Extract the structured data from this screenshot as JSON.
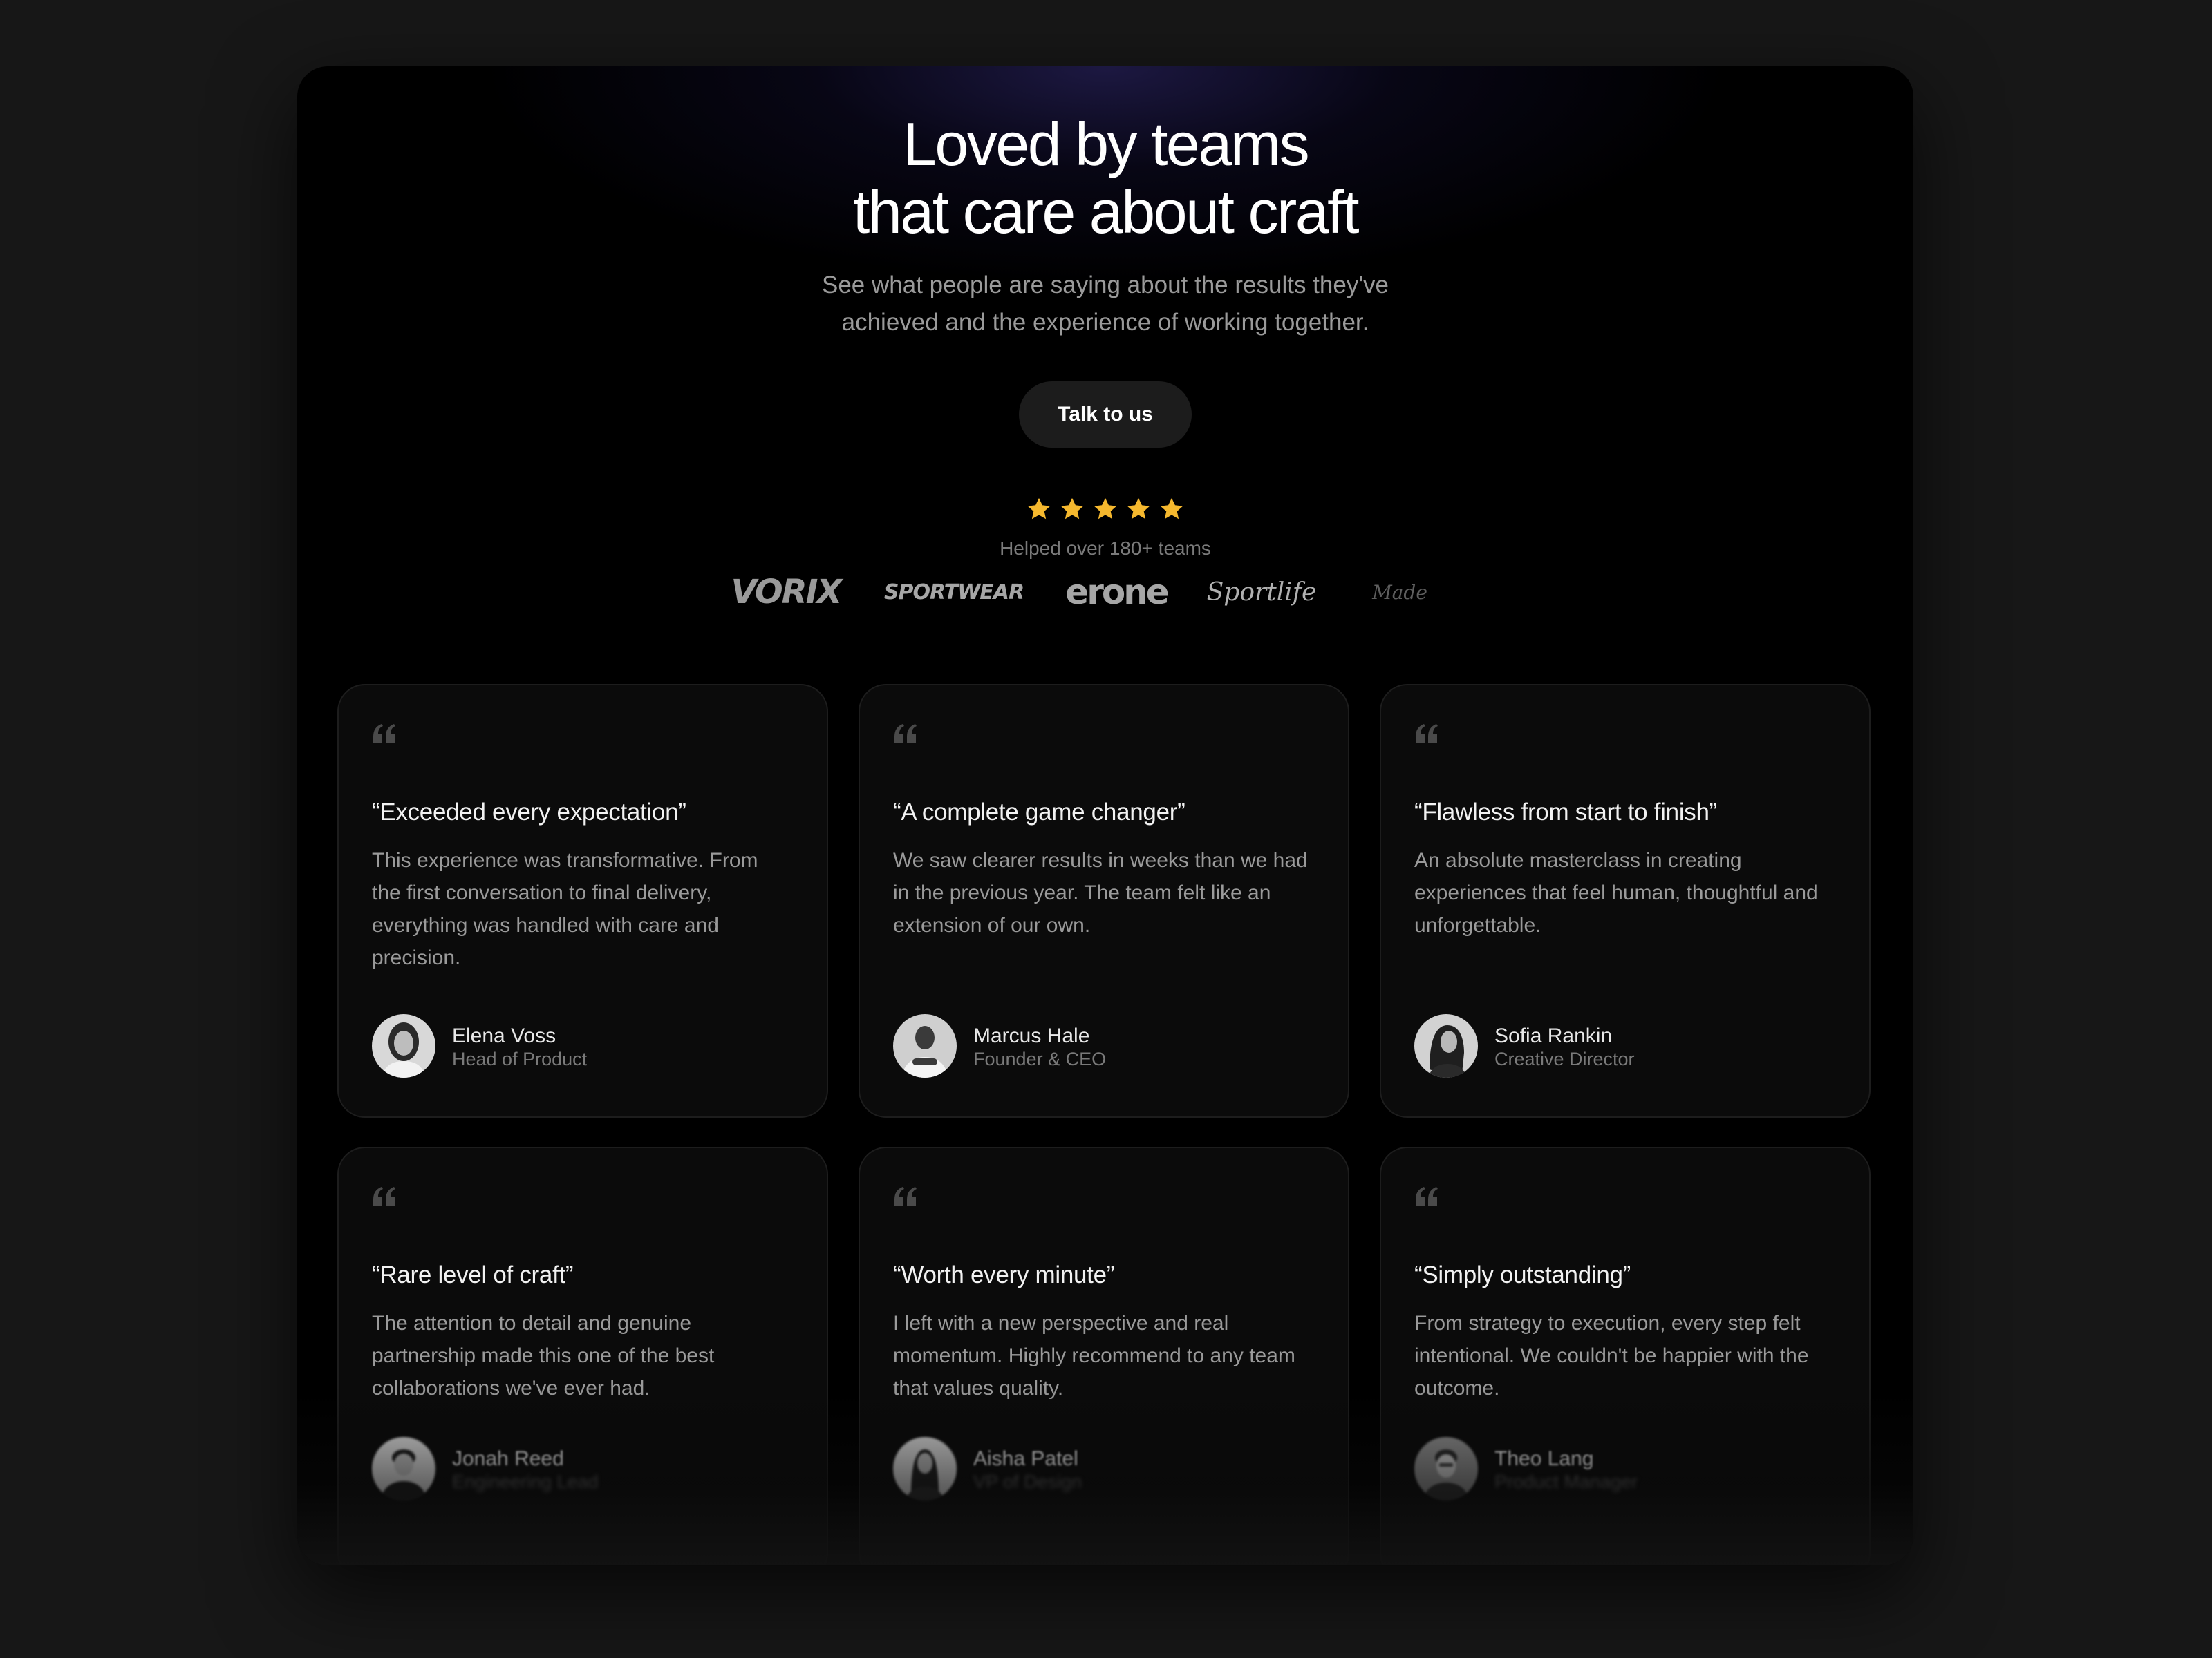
{
  "hero": {
    "headline_line1": "Loved by teams",
    "headline_line2": "that care about craft",
    "subtitle_line1": "See what people are saying about the results they've",
    "subtitle_line2": "achieved and the experience of working together.",
    "cta_label": "Talk to us"
  },
  "rating": {
    "stars": 5,
    "star_color": "#F5B82E",
    "caption": "Helped over 180+ teams"
  },
  "logos": [
    "VORIX",
    "SPORTWEAR",
    "erone",
    "Sportlife",
    "Made"
  ],
  "colors": {
    "background": "#171717",
    "panel": "#000000",
    "card": "#0B0B0B",
    "accent_glow": "#342C78"
  },
  "testimonials": [
    {
      "title": "“Exceeded every expectation”",
      "body": "This experience was transformative. From the first conversation to final delivery, everything was handled with care and precision.",
      "name": "Elena Voss",
      "role": "Head of Product"
    },
    {
      "title": "“A complete game changer”",
      "body": "We saw clearer results in weeks than we had in the previous year. The team felt like an extension of our own.",
      "name": "Marcus Hale",
      "role": "Founder & CEO"
    },
    {
      "title": "“Flawless from start to finish”",
      "body": "An absolute masterclass in creating experiences that feel human, thoughtful and unforgettable.",
      "name": "Sofia Rankin",
      "role": "Creative Director"
    },
    {
      "title": "“Rare level of craft”",
      "body": "The attention to detail and genuine partnership made this one of the best collaborations we've ever had.",
      "name": "Jonah Reed",
      "role": "Engineering Lead"
    },
    {
      "title": "“Worth every minute”",
      "body": "I left with a new perspective and real momentum. Highly recommend to any team that values quality.",
      "name": "Aisha Patel",
      "role": "VP of Design"
    },
    {
      "title": "“Simply outstanding”",
      "body": "From strategy to execution, every step felt intentional. We couldn't be happier with the outcome.",
      "name": "Theo Lang",
      "role": "Product Manager"
    }
  ]
}
